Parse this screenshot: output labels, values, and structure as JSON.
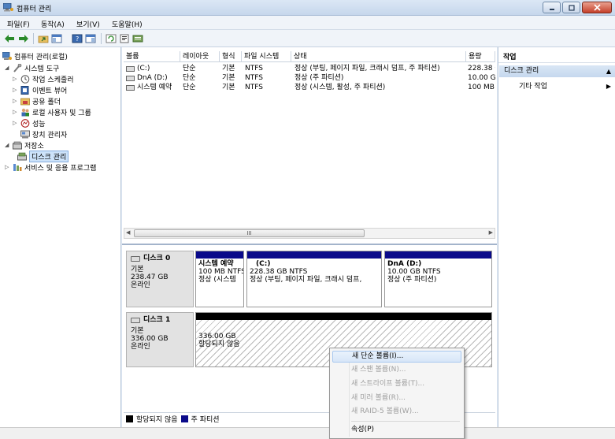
{
  "window": {
    "title": "컴퓨터 관리"
  },
  "menu": [
    "파일(F)",
    "동작(A)",
    "보기(V)",
    "도움말(H)"
  ],
  "tree": {
    "root": "컴퓨터 관리(로컬)",
    "system_tools": "시스템 도구",
    "task_scheduler": "작업 스케줄러",
    "event_viewer": "이벤트 뷰어",
    "shared_folders": "공유 폴더",
    "local_users": "로컬 사용자 및 그룹",
    "performance": "성능",
    "device_manager": "장치 관리자",
    "storage": "저장소",
    "disk_management": "디스크 관리",
    "services": "서비스 및 응용 프로그램"
  },
  "volume_table": {
    "headers": [
      "볼륨",
      "레이아웃",
      "형식",
      "파일 시스템",
      "상태",
      "용량"
    ],
    "rows": [
      [
        "(C:)",
        "단순",
        "기본",
        "NTFS",
        "정상 (부팅, 페이지 파일, 크래시 덤프, 주 파티션)",
        "228.38 G"
      ],
      [
        "DnA (D:)",
        "단순",
        "기본",
        "NTFS",
        "정상 (주 파티션)",
        "10.00 G"
      ],
      [
        "시스템 예약",
        "단순",
        "기본",
        "NTFS",
        "정상 (시스템, 활성, 주 파티션)",
        "100 MB"
      ]
    ]
  },
  "scroll": {
    "thumb_label": "III"
  },
  "disk0": {
    "name": "디스크 0",
    "type": "기본",
    "size": "238.47 GB",
    "status": "온라인",
    "partitions": [
      {
        "name": "시스템 예약",
        "size": "100 MB NTFS",
        "status": "정상 (시스템"
      },
      {
        "name": "(C:)",
        "size": "228.38 GB NTFS",
        "status": "정상 (부팅, 페이지 파일, 크래시 덤프,"
      },
      {
        "name": "DnA  (D:)",
        "size": "10.00 GB NTFS",
        "status": "정상 (주 파티션)"
      }
    ]
  },
  "disk1": {
    "name": "디스크 1",
    "type": "기본",
    "size": "336.00 GB",
    "status": "온라인",
    "unallocated": {
      "size": "336.00 GB",
      "status": "할당되지 않음"
    }
  },
  "legend": {
    "unallocated": "할당되지 않음",
    "primary": "주 파티션"
  },
  "actions": {
    "header": "작업",
    "section": "디스크 관리",
    "more": "기타 작업"
  },
  "context_menu": {
    "new_simple": "새 단순 볼륨(I)...",
    "new_spanned": "새 스팬 볼륨(N)...",
    "new_striped": "새 스트라이프 볼륨(T)...",
    "new_mirrored": "새 미러 볼륨(R)...",
    "new_raid5": "새 RAID-5 볼륨(W)...",
    "properties": "속성(P)"
  },
  "colors": {
    "primary_partition": "#0a0a8a",
    "unallocated": "#000000",
    "accent": "#cde3fa"
  }
}
